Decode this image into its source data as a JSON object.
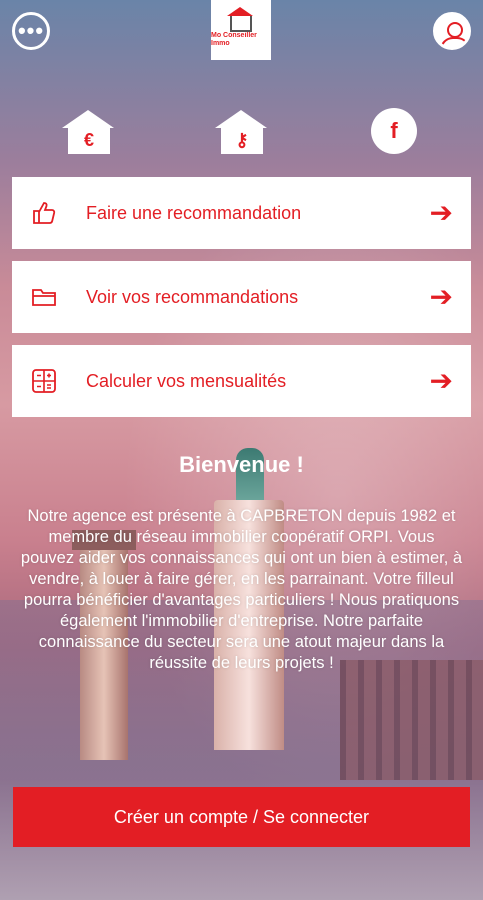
{
  "header": {
    "logo_text": "Mo Conseiller Immo",
    "menu_icon": "more-horizontal-icon",
    "profile_icon": "user-icon"
  },
  "quick_actions": [
    {
      "name": "euro-house-icon",
      "glyph": "€"
    },
    {
      "name": "key-house-icon",
      "glyph": "⚷"
    },
    {
      "name": "facebook-icon",
      "glyph": "f"
    }
  ],
  "menu": [
    {
      "label": "Faire une recommandation",
      "icon": "thumbs-up-icon"
    },
    {
      "label": "Voir vos recommandations",
      "icon": "folder-icon"
    },
    {
      "label": "Calculer vos mensualités",
      "icon": "calculator-icon"
    }
  ],
  "welcome": {
    "title": "Bienvenue !",
    "text": "Notre agence est présente à CAPBRETON depuis 1982 et membre du réseau immobilier coopératif ORPI. Vous pouvez aider vos connaissances qui ont un bien à estimer, à vendre, à louer à faire gérer, en les parrainant. Votre filleul pourra bénéficier d'avantages particuliers ! Nous pratiquons également l'immobilier d'entreprise. Notre parfaite connaissance du secteur sera une atout majeur dans la réussite de leurs projets !"
  },
  "cta": {
    "label": "Créer un compte / Se connecter"
  },
  "colors": {
    "accent": "#e31e24",
    "card_bg": "#ffffff"
  }
}
